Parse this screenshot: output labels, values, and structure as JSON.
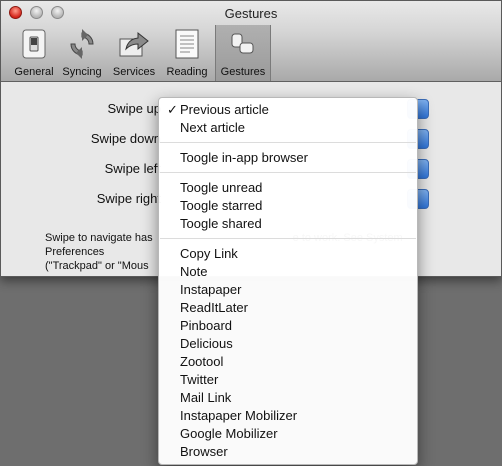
{
  "window": {
    "title": "Gestures"
  },
  "toolbar": {
    "tabs": [
      {
        "label": "General",
        "icon": "switch-icon"
      },
      {
        "label": "Syncing",
        "icon": "sync-icon"
      },
      {
        "label": "Services",
        "icon": "share-icon"
      },
      {
        "label": "Reading",
        "icon": "document-icon"
      },
      {
        "label": "Gestures",
        "icon": "gesture-icon"
      }
    ],
    "selected": "Gestures"
  },
  "gestures": {
    "rows": [
      {
        "label": "Swipe up"
      },
      {
        "label": "Swipe down"
      },
      {
        "label": "Swipe left"
      },
      {
        "label": "Swipe right"
      }
    ],
    "help_line1": "Swipe to navigate has",
    "help_line1_tail": "e to work. See System Preferences",
    "help_line2": "(\"Trackpad\" or \"Mous"
  },
  "menu": {
    "checked_item": "Previous article",
    "groups": [
      [
        "Previous article",
        "Next article"
      ],
      [
        "Toogle in-app browser"
      ],
      [
        "Toogle unread",
        "Toogle starred",
        "Toogle shared"
      ],
      [
        "Copy Link",
        "Note",
        "Instapaper",
        "ReadItLater",
        "Pinboard",
        "Delicious",
        "Zootool",
        "Twitter",
        "Mail Link",
        "Instapaper Mobilizer",
        "Google Mobilizer",
        "Browser"
      ]
    ]
  },
  "colors": {
    "accent": "#3a7bd8",
    "background": "#6e6e6e"
  }
}
